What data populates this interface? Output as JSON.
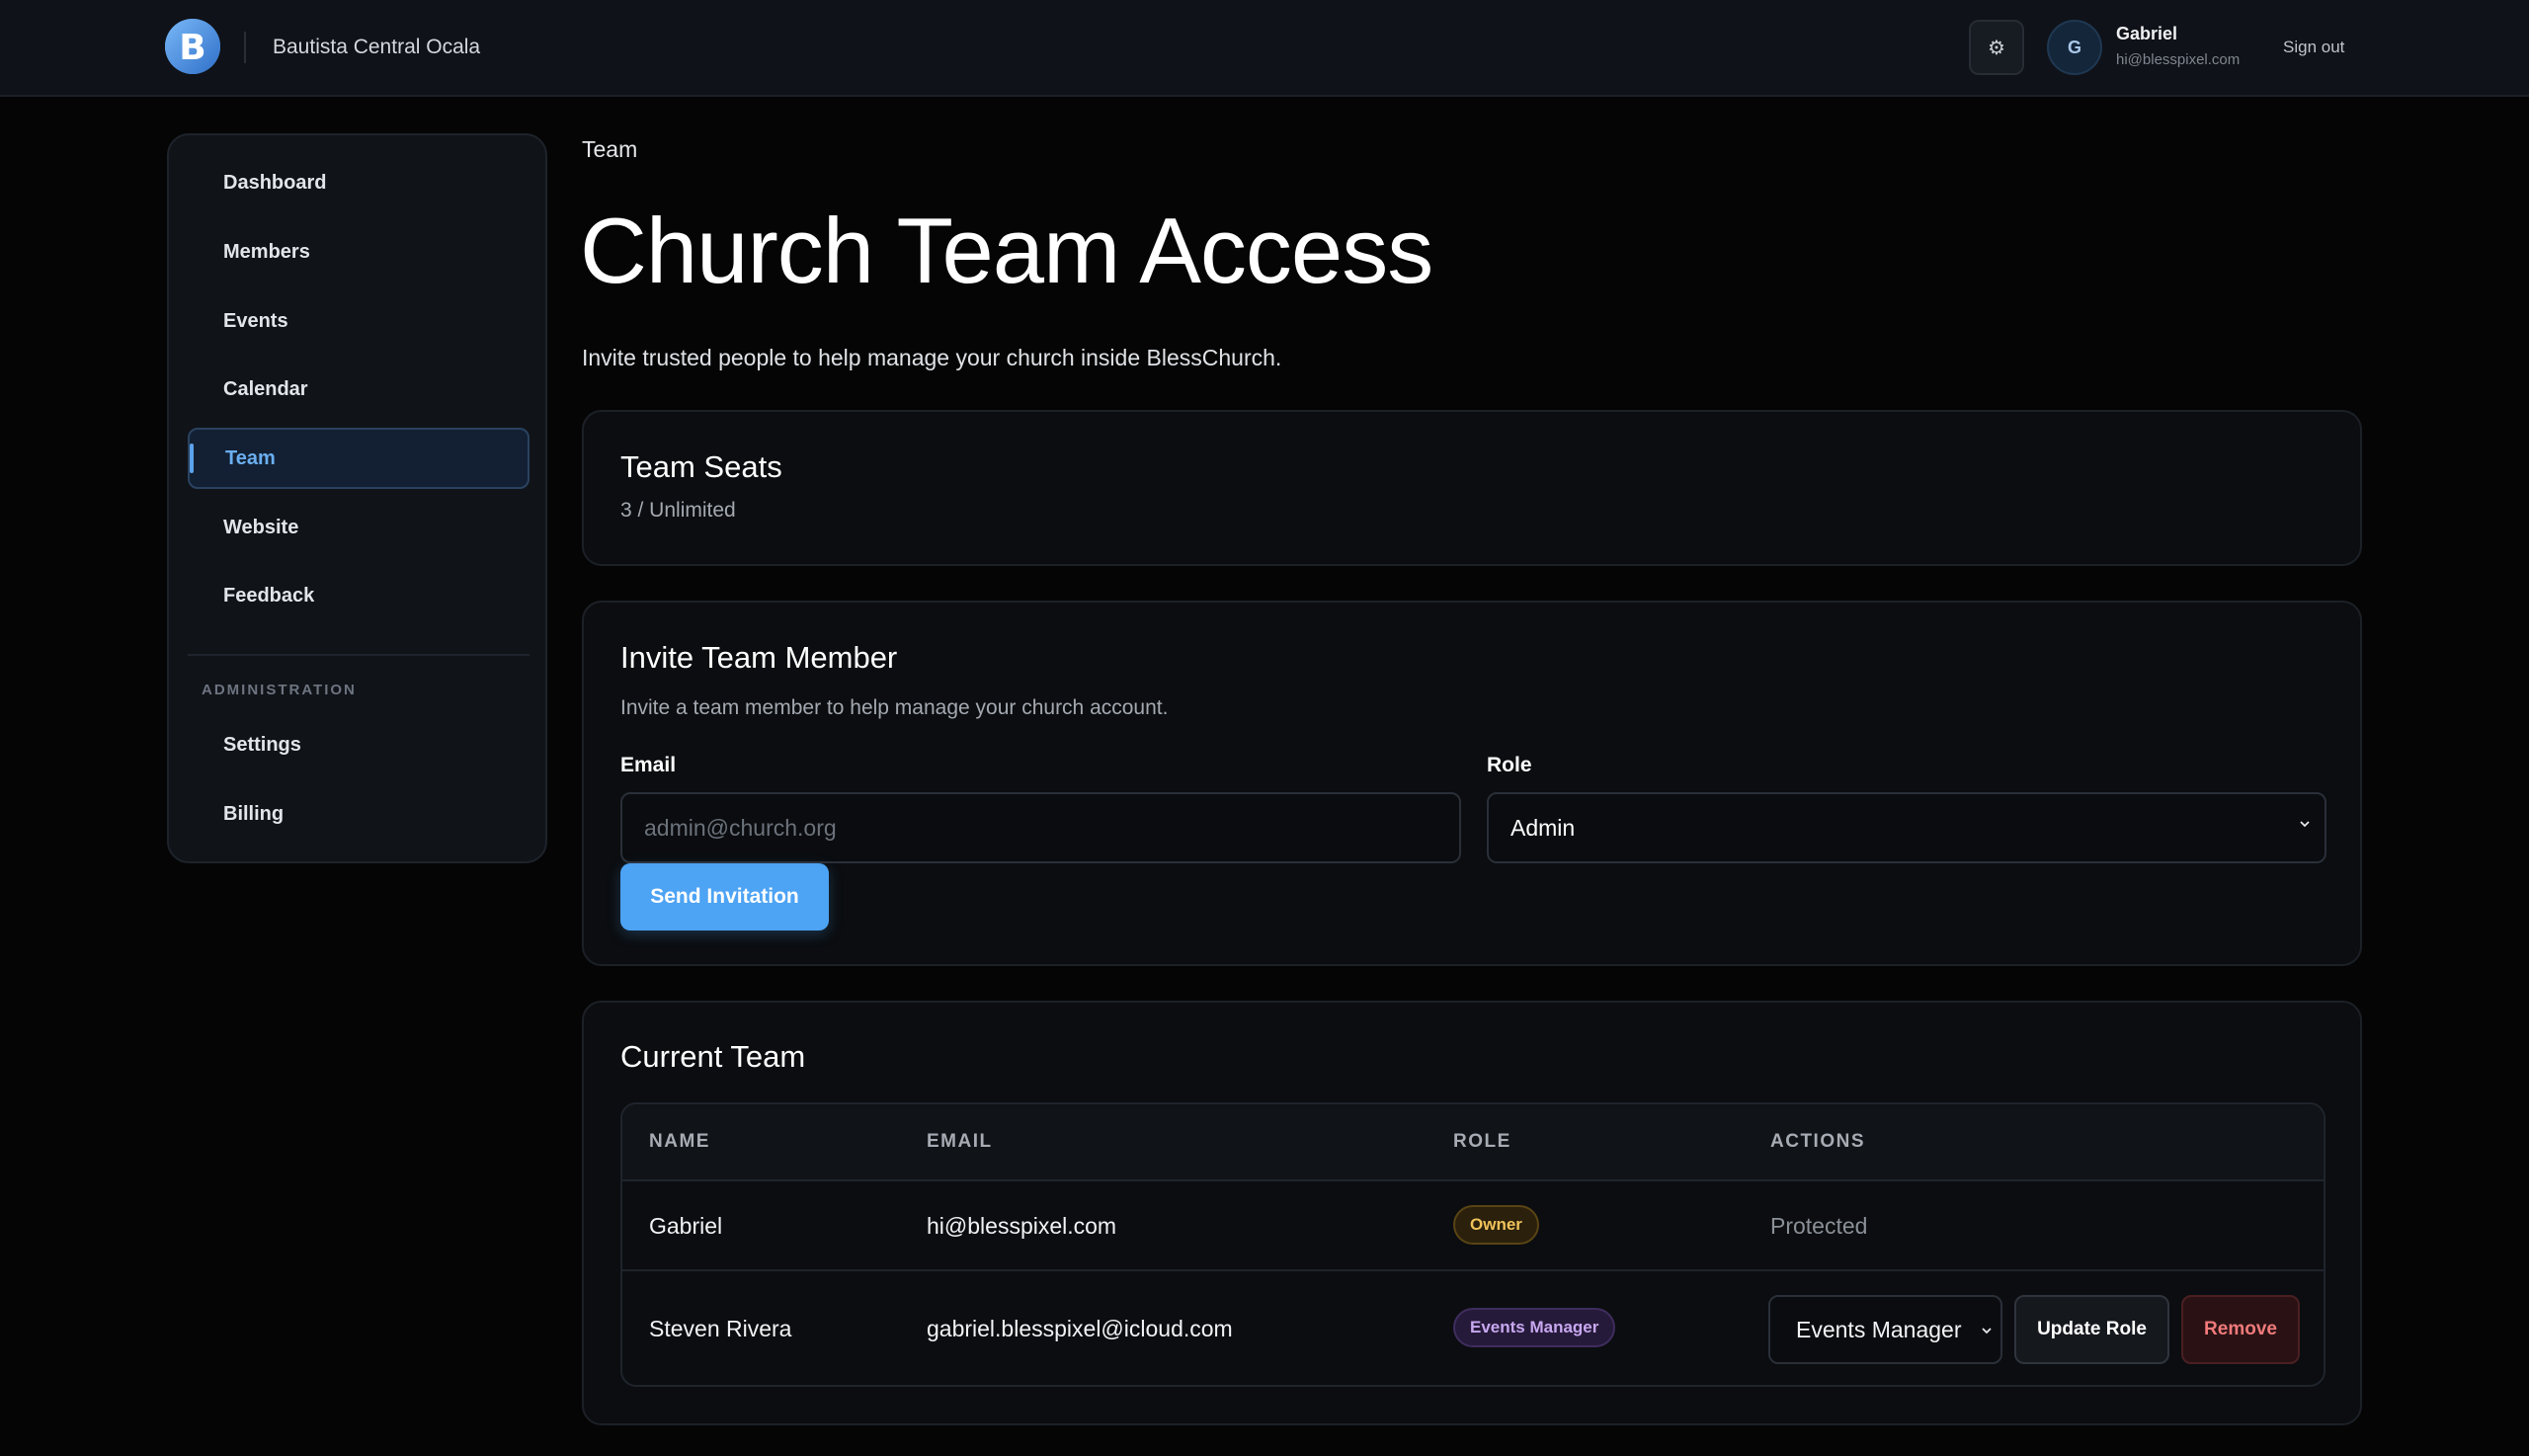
{
  "header": {
    "church_name": "Bautista Central Ocala",
    "settings_icon": "gear-icon",
    "avatar_initial": "G",
    "user_name": "Gabriel",
    "user_email": "hi@blesspixel.com",
    "sign_out": "Sign out"
  },
  "sidebar": {
    "items": [
      {
        "label": "Dashboard"
      },
      {
        "label": "Members"
      },
      {
        "label": "Events"
      },
      {
        "label": "Calendar"
      },
      {
        "label": "Team",
        "active": true
      },
      {
        "label": "Website"
      },
      {
        "label": "Feedback"
      }
    ],
    "admin_section": "ADMINISTRATION",
    "admin_items": [
      {
        "label": "Settings"
      },
      {
        "label": "Billing"
      }
    ]
  },
  "main": {
    "breadcrumb": "Team",
    "title": "Church Team Access",
    "subtitle": "Invite trusted people to help manage your church inside BlessChurch.",
    "seats": {
      "title": "Team Seats",
      "value": "3 / Unlimited"
    },
    "invite": {
      "title": "Invite Team Member",
      "description": "Invite a team member to help manage your church account.",
      "email_label": "Email",
      "email_placeholder": "admin@church.org",
      "role_label": "Role",
      "role_value": "Admin",
      "submit_label": "Send Invitation"
    },
    "team": {
      "title": "Current Team",
      "columns": [
        "NAME",
        "EMAIL",
        "ROLE",
        "ACTIONS"
      ],
      "rows": [
        {
          "name": "Gabriel",
          "email": "hi@blesspixel.com",
          "role": "Owner",
          "action": "Protected"
        },
        {
          "name": "Steven Rivera",
          "email": "gabriel.blesspixel@icloud.com",
          "role": "Events Manager",
          "role_select": "Events Manager",
          "update_label": "Update Role",
          "remove_label": "Remove"
        }
      ]
    }
  },
  "colors": {
    "accent": "#4da3f4",
    "background": "#050505",
    "owner_badge": "#f0c25a",
    "events_badge": "#c8a8f0",
    "danger": "#f07a7a"
  }
}
